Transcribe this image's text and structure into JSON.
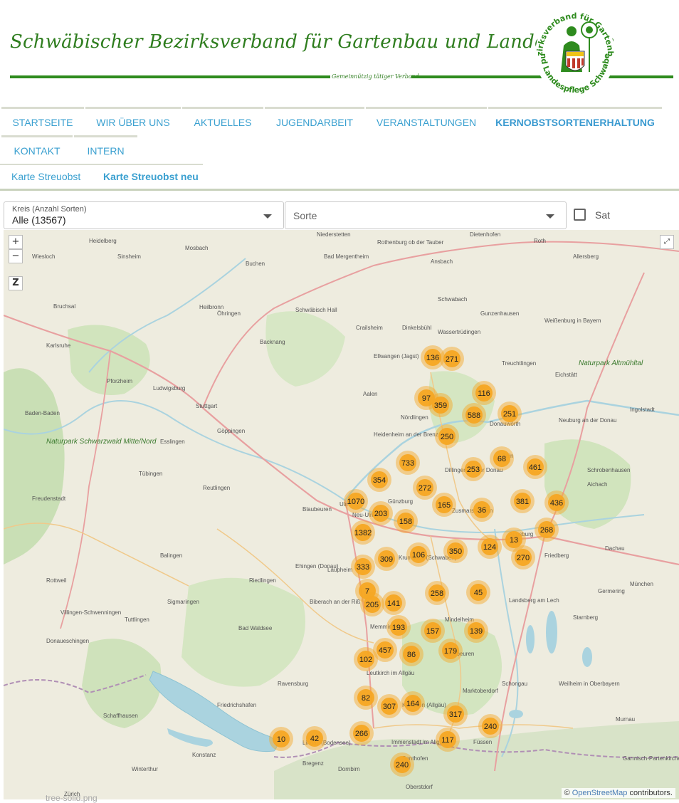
{
  "header": {
    "title": "Schwäbischer Bezirksverband für Gartenbau und Landespflege",
    "tagline": "Gemeinnützig tätiger Verband",
    "logo_ring_top": "Bezirksverband für Gartenbau",
    "logo_ring_bottom": "und Landespflege Schwaben",
    "brand_color": "#2e8b1e"
  },
  "nav": {
    "items": [
      {
        "label": "STARTSEITE"
      },
      {
        "label": "WIR ÜBER UNS"
      },
      {
        "label": "AKTUELLES"
      },
      {
        "label": "JUGENDARBEIT"
      },
      {
        "label": "VERANSTALTUNGEN"
      },
      {
        "label": "KERNOBSTSORTENERHALTUNG"
      },
      {
        "label": "KONTAKT"
      },
      {
        "label": "INTERN"
      }
    ],
    "sub_items": [
      {
        "label": "Karte Streuobst"
      },
      {
        "label": "Karte Streuobst neu"
      }
    ],
    "link_color": "#3aa0d0"
  },
  "filters": {
    "kreis_label": "Kreis (Anzahl Sorten)",
    "kreis_value": "Alle (13567)",
    "sorte_placeholder": "Sorte",
    "sat_label": "Sat"
  },
  "map": {
    "controls": {
      "zoom_in": "+",
      "zoom_out": "−",
      "z": "Z"
    },
    "attribution_prefix": "© ",
    "attribution_osm": "OpenStreetMap",
    "attribution_suffix": " contributors.",
    "cluster_color": "#f5a623",
    "clusters": [
      "136",
      "271",
      "97",
      "359",
      "116",
      "588",
      "251",
      "250",
      "733",
      "354",
      "68",
      "253",
      "461",
      "272",
      "1070",
      "203",
      "165",
      "36",
      "381",
      "436",
      "1382",
      "158",
      "13",
      "268",
      "124",
      "106",
      "350",
      "309",
      "270",
      "333",
      "258",
      "45",
      "7",
      "205",
      "141",
      "193",
      "157",
      "139",
      "457",
      "86",
      "179",
      "102",
      "82",
      "307",
      "164",
      "317",
      "240",
      "10",
      "42",
      "266",
      "117",
      "240"
    ],
    "places": [
      "Heidelberg",
      "Mosbach",
      "Niederstetten",
      "Rothenburg ob der Tauber",
      "Dietenhofen",
      "Roth",
      "Allersberg",
      "Wiesloch",
      "Sinsheim",
      "Buchen",
      "Bad Mergentheim",
      "Ansbach",
      "Schwabach",
      "Heilbronn",
      "Schwäbisch Hall",
      "Crailsheim",
      "Dinkelsbühl",
      "Gunzenhausen",
      "Weißenburg in Bayern",
      "Karlsruhe",
      "Öhringen",
      "Ellwangen (Jagst)",
      "Wassertrüdingen",
      "Treuchtlingen",
      "Eichstätt",
      "Bruchsal",
      "Backnang",
      "Aalen",
      "Nördlingen",
      "Donauwörth",
      "Neuburg an der Donau",
      "Ingolstadt",
      "Pforzheim",
      "Stuttgart",
      "Ludwigsburg",
      "Göppingen",
      "Heidenheim an der Brenz",
      "Dillingen an der Donau",
      "Rain",
      "Schrobenhausen",
      "Baden-Baden",
      "Esslingen",
      "Reutlingen",
      "Günzburg",
      "Augsburg",
      "Aichach",
      "Ulm",
      "Neu-Ulm",
      "Zusmarshausen",
      "Friedberg",
      "Tübingen",
      "Blaubeuren",
      "Ehingen (Donau)",
      "Krumbach (Schwaben)",
      "Dachau",
      "Freudenstadt",
      "Balingen",
      "Riedlingen",
      "Laupheim",
      "Mindelheim",
      "Landsberg am Lech",
      "Germering",
      "München",
      "Rottweil",
      "Sigmaringen",
      "Biberach an der Riß",
      "Memmingen",
      "Kaufbeuren",
      "Starnberg",
      "Villingen-Schwenningen",
      "Tuttlingen",
      "Bad Waldsee",
      "Leutkirch im Allgäu",
      "Marktoberdorf",
      "Weilheim in Oberbayern",
      "Donaueschingen",
      "Ravensburg",
      "Kempten (Allgäu)",
      "Schongau",
      "Murnau",
      "Friedrichshafen",
      "Lindau (Bodensee)",
      "Immenstadt im Allgäu",
      "Füssen",
      "Konstanz",
      "Bregenz",
      "Sonthofen",
      "Garmisch-Partenkirchen",
      "Schaffhausen",
      "Winterthur",
      "Dornbirn",
      "Oberstdorf",
      "Zürich",
      "Naturpark Schwarzwald Mitte/Nord",
      "Naturpark Altmühltal"
    ]
  },
  "footer": {
    "file_text": "tree-solid.png"
  }
}
